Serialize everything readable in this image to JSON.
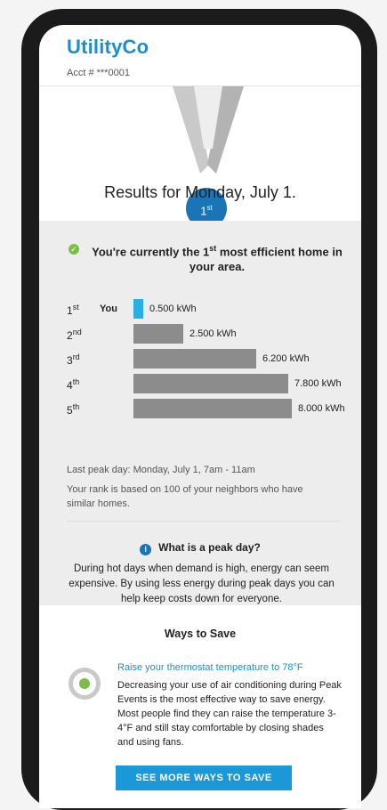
{
  "header": {
    "brand": "UtilityCo",
    "account": "Acct # ***0001"
  },
  "badge": {
    "rank_main": "1",
    "rank_suffix": "st"
  },
  "results_title": "Results for Monday, July 1.",
  "statement": {
    "prefix": "You're currently the 1",
    "suffix_sup": "st",
    "rest": " most efficient home in your area."
  },
  "ranking": [
    {
      "rank": "1",
      "suffix": "st",
      "label": "You",
      "value": 0.5,
      "display": "0.500 kWh",
      "color": "#29aee6"
    },
    {
      "rank": "2",
      "suffix": "nd",
      "label": "",
      "value": 2.5,
      "display": "2.500 kWh",
      "color": "#8c8c8c"
    },
    {
      "rank": "3",
      "suffix": "rd",
      "label": "",
      "value": 6.2,
      "display": "6.200 kWh",
      "color": "#8c8c8c"
    },
    {
      "rank": "4",
      "suffix": "th",
      "label": "",
      "value": 7.8,
      "display": "7.800 kWh",
      "color": "#8c8c8c"
    },
    {
      "rank": "5",
      "suffix": "th",
      "label": "",
      "value": 8.0,
      "display": "8.000 kWh",
      "color": "#8c8c8c"
    }
  ],
  "last_peak": "Last peak day: Monday, July 1, 7am - 11am",
  "rank_note": "Your rank is based on 100 of your neighbors who have similar homes.",
  "peak_day": {
    "heading": "What is a peak day?",
    "text": "During hot days when demand is high, energy can seem expensive. By using less energy during peak days you can help keep costs down for everyone."
  },
  "ways": {
    "title": "Ways to Save",
    "tip_title": "Raise your thermostat temperature to 78°F",
    "tip_text": "Decreasing your use of air conditioning during Peak Events is the most effective way to save energy. Most people find they can raise the temperature 3-4°F and still stay comfortable by closing shades and using fans.",
    "cta": "SEE MORE WAYS TO SAVE"
  },
  "colors": {
    "brand": "#1a8fd0",
    "you_bar": "#29aee6",
    "other_bar": "#8c8c8c",
    "check": "#7bbd45"
  }
}
